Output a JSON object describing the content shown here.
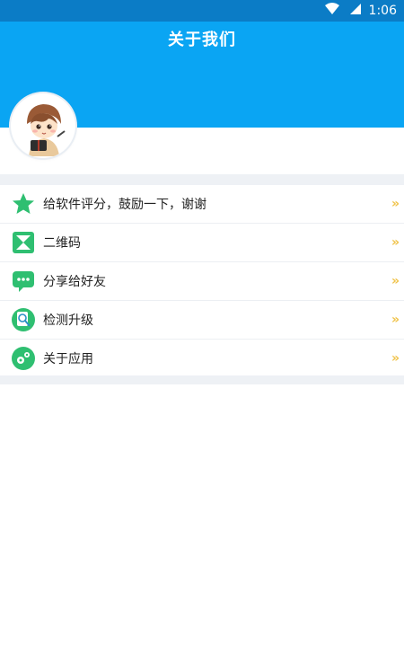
{
  "status_bar": {
    "time": "1:06",
    "icons": [
      "wifi-icon",
      "cellular-icon"
    ]
  },
  "header": {
    "title": "关于我们",
    "bg_color": "#0aa5f3"
  },
  "profile": {
    "avatar_icon": "avatar"
  },
  "menu": {
    "items": [
      {
        "icon": "star-icon",
        "label": "给软件评分，鼓励一下，谢谢"
      },
      {
        "icon": "qr-code-icon",
        "label": "二维码"
      },
      {
        "icon": "share-icon",
        "label": "分享给好友"
      },
      {
        "icon": "search-update-icon",
        "label": "检测升级"
      },
      {
        "icon": "about-app-icon",
        "label": "关于应用"
      }
    ],
    "chevron_color": "#f0c34b"
  }
}
